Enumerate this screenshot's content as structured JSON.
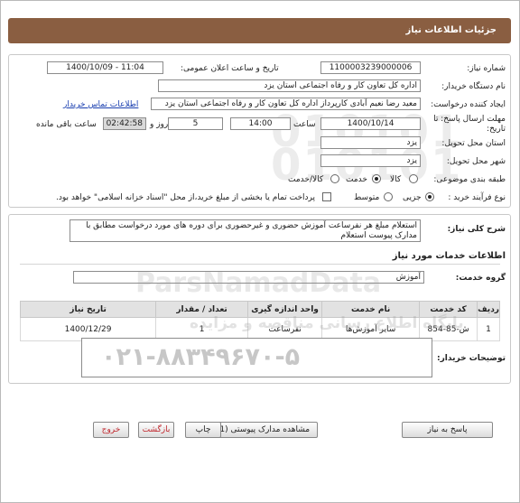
{
  "header": {
    "title": "جزئیات اطلاعات نیاز"
  },
  "fields": {
    "need_number_label": "شماره نیاز:",
    "need_number": "1100003239000006",
    "announce_label": "تاریخ و ساعت اعلان عمومی:",
    "announce_value": "1400/10/09 - 11:04",
    "buyer_org_label": "نام دستگاه خریدار:",
    "buyer_org": "اداره کل تعاون  کار و رفاه اجتماعی استان یزد",
    "creator_label": "ایجاد کننده درخواست:",
    "creator": "معید رضا  نعیم آبادی کارپرداز اداره کل تعاون  کار و رفاه اجتماعی استان یزد",
    "contact_link": "اطلاعات تماس خریدار",
    "deadline_label": "مهلت ارسال پاسخ: تا تاریخ:",
    "deadline_date": "1400/10/14",
    "time_label": "ساعت",
    "deadline_time": "14:00",
    "days_value": "5",
    "days_label": "روز و",
    "remaining_time": "02:42:58",
    "remaining_label": "ساعت باقی مانده",
    "province_label": "استان محل تحویل:",
    "province": "یزد",
    "city_label": "شهر محل تحویل:",
    "city": "یزد",
    "category_label": "طبقه بندی موضوعی:",
    "category_options": [
      "کالا",
      "خدمت",
      "کالا/خدمت"
    ],
    "category_selected": "خدمت",
    "process_label": "نوع فرآیند خرید :",
    "process_options": [
      "جزیی",
      "متوسط"
    ],
    "process_selected": "جزیی",
    "payment_note": "پرداخت تمام یا بخشی از مبلغ خرید،از محل \"اسناد خزانه اسلامی\" خواهد بود."
  },
  "summary": {
    "label": "شرح کلی نیاز:",
    "text": "استعلام مبلغ هر نفرساعت آموزش حضوری و غیرحضوری برای دوره های مورد درخواست مطابق با مدارک پیوست استعلام"
  },
  "services": {
    "section_title": "اطلاعات خدمات مورد نیاز",
    "group_label": "گروه خدمت:",
    "group_value": "آموزش",
    "columns": [
      "ردیف",
      "کد خدمت",
      "نام خدمت",
      "واحد اندازه گیری",
      "تعداد / مقدار",
      "تاریخ نیاز"
    ],
    "rows": [
      [
        "1",
        "ش-85-854",
        "سایر آموزش‌ها",
        "نفرساعت",
        "1",
        "1400/12/29"
      ]
    ]
  },
  "buyer_notes": {
    "label": "توضیحات خریدار:",
    "value": ""
  },
  "watermark": {
    "brand": "ParsNamadData",
    "subtitle": "پایگاه اطلاع رسانی مناقصه و مزایده",
    "phone": "۰۲۱-۸۸۳۴۹۶۷۰-۵",
    "digits": "010101"
  },
  "buttons": {
    "reply": "پاسخ به نیاز",
    "attachments": "مشاهده مدارک پیوستی (1)",
    "print": "چاپ",
    "back": "بازگشت",
    "exit": "خروج"
  }
}
